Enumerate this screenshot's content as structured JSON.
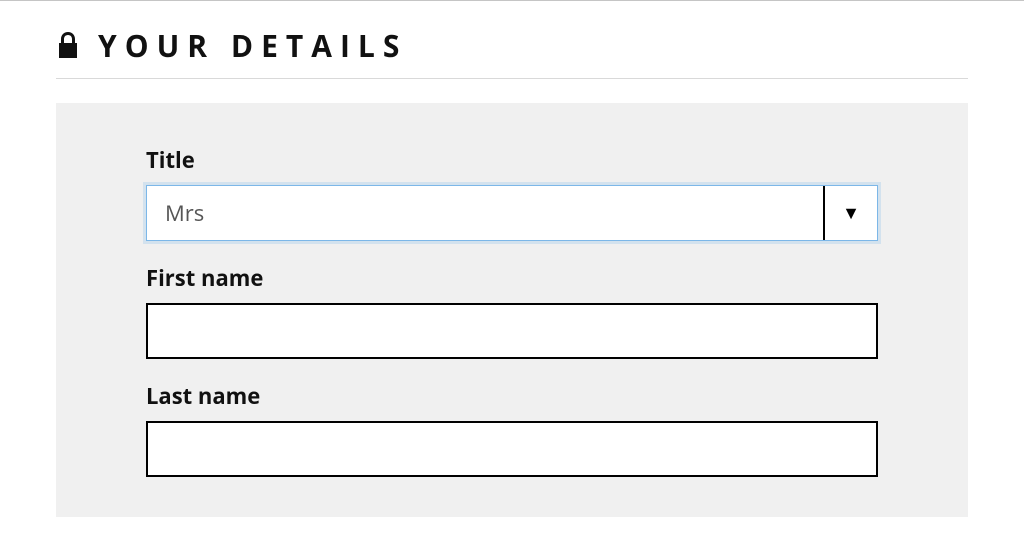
{
  "section": {
    "title": "YOUR DETAILS"
  },
  "form": {
    "title_field": {
      "label": "Title",
      "value": "Mrs"
    },
    "first_name": {
      "label": "First name",
      "value": ""
    },
    "last_name": {
      "label": "Last name",
      "value": ""
    }
  }
}
